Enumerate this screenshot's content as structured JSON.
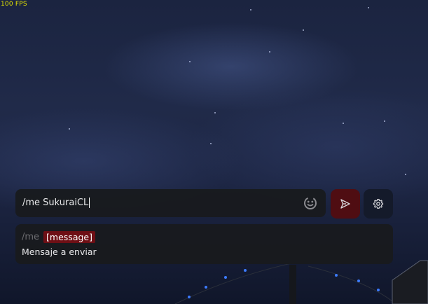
{
  "hud": {
    "fps": "100 FPS"
  },
  "chat": {
    "input_value": "/me SukuraiCL",
    "icons": {
      "emoji": "emoji-icon",
      "send": "send-icon",
      "settings": "gear-icon"
    },
    "suggestion": {
      "command": "/me",
      "param": "[message]",
      "description": "Mensaje a enviar"
    }
  },
  "colors": {
    "send_bg": "#4f0d12",
    "settings_bg": "#141a2a",
    "param_bg": "#6e0f15",
    "fps": "#e6e600"
  }
}
